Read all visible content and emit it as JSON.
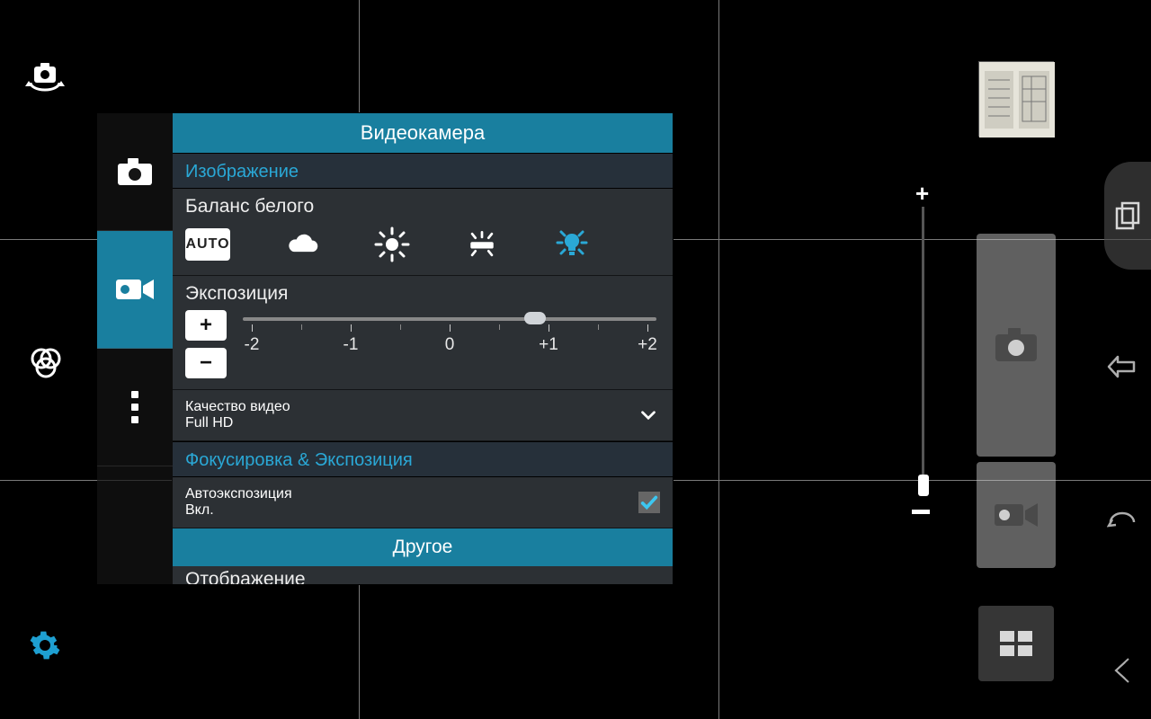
{
  "panel": {
    "title": "Видеокамера",
    "image_section": "Изображение",
    "wb": {
      "label": "Баланс белого",
      "auto_text": "AUTO",
      "options": [
        "auto",
        "cloudy",
        "daylight",
        "fluorescent",
        "incandescent"
      ],
      "selected": "incandescent"
    },
    "exposure": {
      "label": "Экспозиция",
      "ticks": [
        "-2",
        "-1",
        "0",
        "+1",
        "+2"
      ],
      "value": 0.9,
      "plus": "+",
      "minus": "−"
    },
    "quality": {
      "label": "Качество видео",
      "value": "Full HD"
    },
    "focus_section": "Фокусировка & Экспозиция",
    "auto_exposure": {
      "label": "Автоэкспозиция",
      "value": "Вкл.",
      "checked": true
    },
    "footer": "Другое",
    "cutoff_label": "Отображение"
  },
  "zoom": {
    "plus": "+",
    "minus": "−"
  },
  "icons": {
    "switch_cam": "switch-camera",
    "filters": "color-filters",
    "settings": "gear",
    "photo": "camera",
    "video": "videocam",
    "more": "more-vertical"
  },
  "colors": {
    "accent": "#197f9f",
    "accent2": "#2aa8d6"
  }
}
